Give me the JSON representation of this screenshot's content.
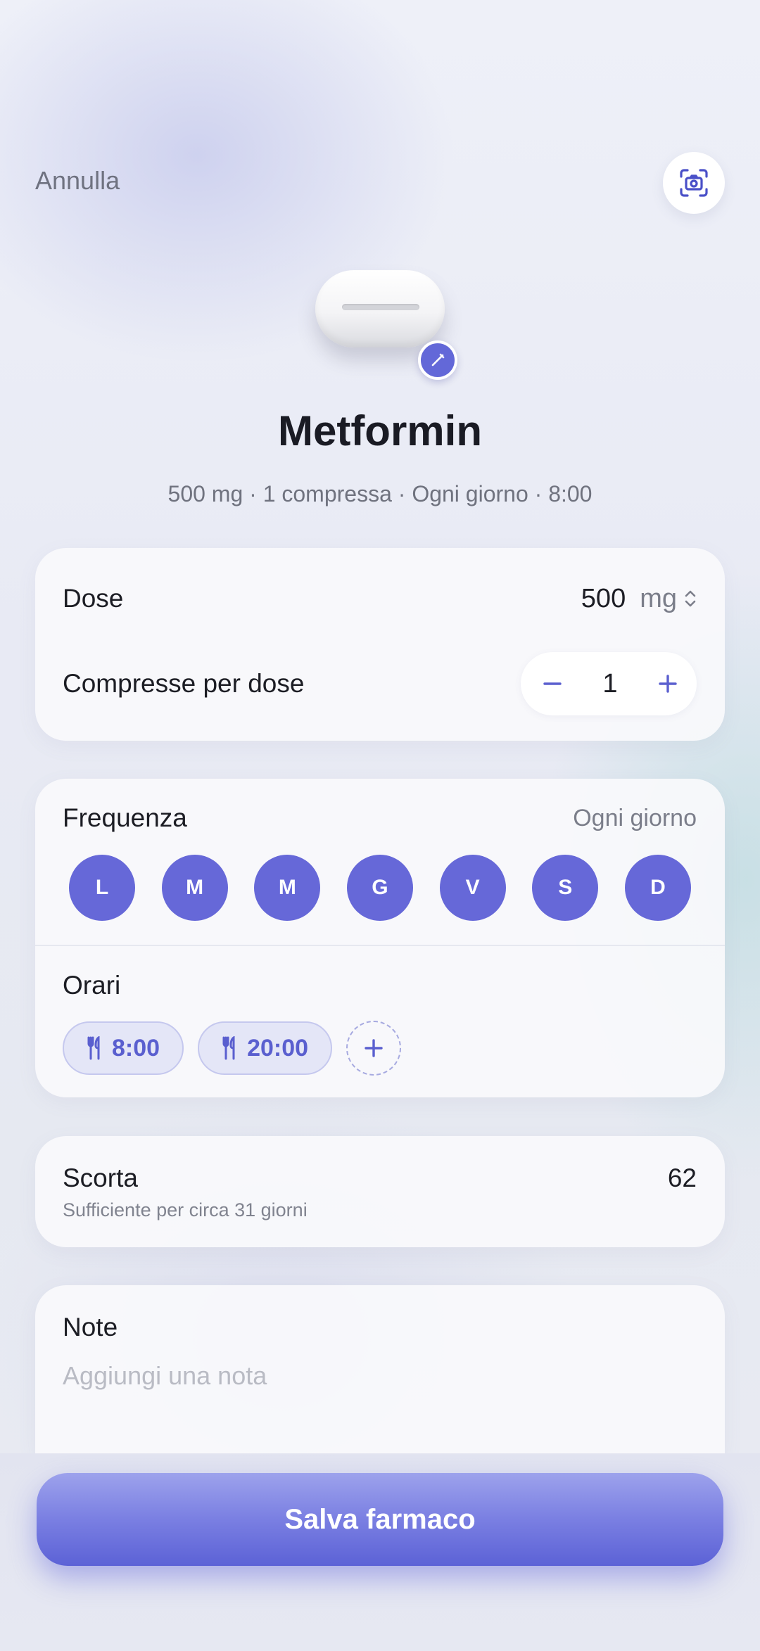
{
  "header": {
    "cancel_label": "Annulla",
    "scan_icon": "camera-scan-icon"
  },
  "medication": {
    "pill_icon": "pill-icon",
    "edit_icon": "pencil-icon",
    "name": "Metformin",
    "summary": "500 mg · 1 compressa · Ogni giorno · 8:00"
  },
  "dose_card": {
    "dose_label": "Dose",
    "dose_value": "500",
    "dose_unit": "mg",
    "tablets_label": "Compresse per dose",
    "tablets_value": "1"
  },
  "frequency_card": {
    "frequency_label": "Frequenza",
    "frequency_value": "Ogni giorno",
    "days": [
      "L",
      "M",
      "M",
      "G",
      "V",
      "S",
      "D"
    ],
    "times_label": "Orari",
    "times": [
      {
        "icon": "fork-knife-icon",
        "value": "8:00"
      },
      {
        "icon": "fork-knife-icon",
        "value": "20:00"
      }
    ]
  },
  "stock_card": {
    "label": "Scorta",
    "value": "62",
    "subtitle": "Sufficiente per circa 31 giorni"
  },
  "note_card": {
    "label": "Note",
    "placeholder": "Aggiungi una nota"
  },
  "footer": {
    "save_label": "Salva farmaco"
  },
  "colors": {
    "accent": "#6668d8",
    "chip_bg": "#e4e6f7",
    "text_primary": "#1c1d24",
    "text_muted": "#7b7e8a"
  }
}
